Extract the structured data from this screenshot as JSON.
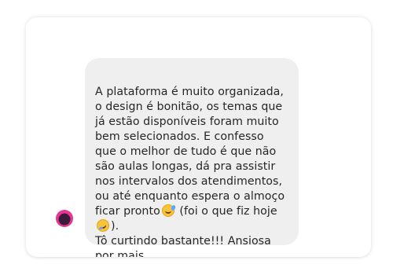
{
  "message": {
    "part1": "A plataforma é muito organizada, o design é bonitão, os temas que já estão disponíveis foram muito bem selecionados. E confesso que o melhor de tudo é que não são aulas longas, dá pra assistir nos intervalos dos atendimentos, ou até enquanto espera o almoço ficar pronto",
    "part2": " (foi o que fiz hoje",
    "part3": ").",
    "part4": "Tô curtindo bastante!!! Ansiosa por mais...",
    "emoji1": "grinning-face-with-sweat-icon",
    "emoji2": "rolling-on-floor-laughing-icon"
  }
}
